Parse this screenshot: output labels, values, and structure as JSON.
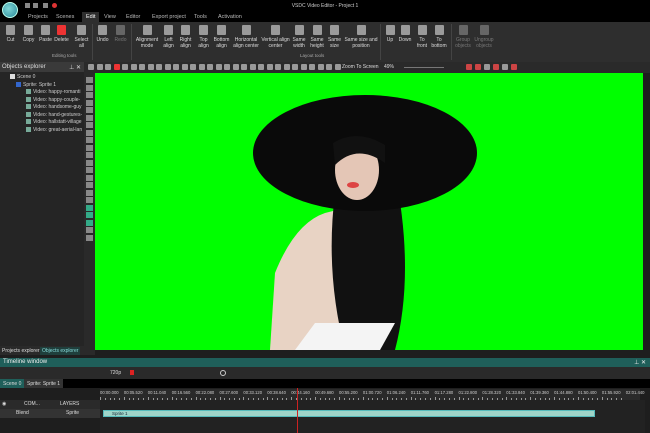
{
  "app": {
    "title": "VSDC Video Editor - Project 1"
  },
  "menu": [
    "Projects",
    "Scenes",
    "Edit",
    "View",
    "Editor",
    "Export project",
    "Tools",
    "Activation"
  ],
  "menu_active": "Edit",
  "ribbon": {
    "editing": [
      {
        "label": "Cut",
        "icon": "scissors-icon"
      },
      {
        "label": "Copy",
        "icon": "copy-icon"
      },
      {
        "label": "Paste",
        "icon": "paste-icon"
      },
      {
        "label": "Delete",
        "icon": "delete-x-icon"
      },
      {
        "label": "Select all",
        "icon": "select-all-icon"
      }
    ],
    "undo": "Undo",
    "redo": "Redo",
    "editing_group": "Editing tools",
    "layout": [
      {
        "label": "Alignment mode"
      },
      {
        "label": "Left align"
      },
      {
        "label": "Right align"
      },
      {
        "label": "Top align"
      },
      {
        "label": "Bottom align"
      },
      {
        "label": "Horizontal align center"
      },
      {
        "label": "Vertical align center"
      },
      {
        "label": "Same width"
      },
      {
        "label": "Same height"
      },
      {
        "label": "Same size"
      },
      {
        "label": "Same size and position"
      }
    ],
    "layout_group": "Layout tools",
    "order": [
      {
        "label": "Up"
      },
      {
        "label": "Down"
      },
      {
        "label": "To front"
      },
      {
        "label": "To bottom"
      }
    ],
    "group": [
      {
        "label": "Group objects"
      },
      {
        "label": "Ungroup objects"
      }
    ]
  },
  "toolbar": {
    "zoom_label": "Zoom To Screen",
    "zoom_value": "49%"
  },
  "objects_explorer": {
    "title": "Objects explorer",
    "scene": "Scene 0",
    "sprite": "Sprite: Sprite 1",
    "items": [
      "Video: happy-romanti",
      "Video: happy-couple-",
      "Video: handsome-guy",
      "Video: hand-gestures-",
      "Video: hallstatt-village",
      "Video: great-aerial-lan"
    ]
  },
  "bottom_tabs": [
    "Projects explorer",
    "Objects explorer"
  ],
  "timeline": {
    "title": "Timeline window",
    "resolution": "720p",
    "scene_tabs": [
      "Scene 0",
      "Sprite: Sprite 1"
    ],
    "ticks": [
      "00:00.000",
      "00:05.520",
      "00:11.040",
      "00:16.560",
      "00:22.080",
      "00:27.600",
      "00:33.120",
      "00:38.640",
      "00:44.160",
      "00:49.680",
      "00:55.200",
      "01:00.720",
      "01:06.240",
      "01:11.760",
      "01:17.280",
      "01:22.800",
      "01:28.320",
      "01:33.840",
      "01:39.360",
      "01:44.880",
      "01:50.400",
      "01:55.920",
      "02:01.440"
    ],
    "layer_header": {
      "com": "COM...",
      "layers": "LAYERS"
    },
    "row": {
      "blend": "Blend",
      "name": "Sprite"
    },
    "clip": "Sprite 1",
    "accent": "#1f5f5a"
  }
}
